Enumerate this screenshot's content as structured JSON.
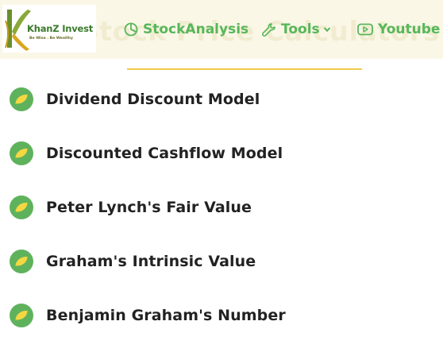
{
  "logo": {
    "name": "KhanZ Invest",
    "tagline": "Be Wise . Be Wealthy"
  },
  "page_title": "Stock Price Calculators",
  "nav": {
    "items": [
      {
        "label": "StockAnalysis",
        "icon": "pie-chart-icon"
      },
      {
        "label": "Tools",
        "icon": "wrench-icon",
        "has_dropdown": true
      },
      {
        "label": "Youtube",
        "icon": "youtube-icon"
      }
    ]
  },
  "calculators": [
    {
      "label": "Dividend Discount Model",
      "icon": "leaf-icon"
    },
    {
      "label": "Discounted Cashflow Model",
      "icon": "leaf-icon"
    },
    {
      "label": "Peter Lynch's Fair Value",
      "icon": "leaf-icon"
    },
    {
      "label": "Graham's Intrinsic Value",
      "icon": "leaf-icon"
    },
    {
      "label": "Benjamin Graham's Number",
      "icon": "leaf-icon"
    }
  ],
  "colors": {
    "header_bg": "#fbf7e7",
    "nav_green": "#57b75a",
    "icon_green": "#5fb25c",
    "leaf_yellow": "#f5d742",
    "divider_yellow": "#f2c94c",
    "text_dark": "#222222"
  }
}
